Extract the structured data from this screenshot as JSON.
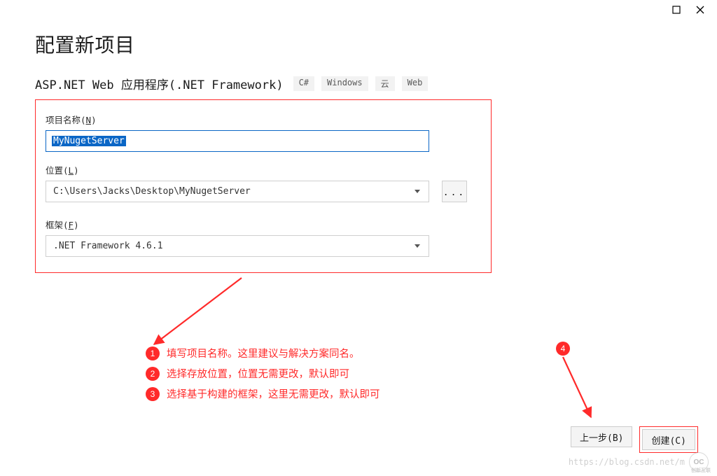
{
  "titlebar": {
    "maximize_icon": "maximize",
    "close_icon": "close"
  },
  "header": {
    "title": "配置新项目",
    "project_type": "ASP.NET Web 应用程序(.NET Framework)",
    "tags": [
      "C#",
      "Windows",
      "云",
      "Web"
    ]
  },
  "form": {
    "project_name": {
      "label_pre": "项目名称(",
      "hotkey": "N",
      "label_post": ")",
      "value": "MyNugetServer"
    },
    "location": {
      "label_pre": "位置(",
      "hotkey": "L",
      "label_post": ")",
      "value": "C:\\Users\\Jacks\\Desktop\\MyNugetServer",
      "browse": "..."
    },
    "framework": {
      "label_pre": "框架(",
      "hotkey": "F",
      "label_post": ")",
      "value": ".NET Framework 4.6.1"
    }
  },
  "annotations": {
    "items": [
      {
        "n": "1",
        "text": "填写项目名称。这里建议与解决方案同名。"
      },
      {
        "n": "2",
        "text": "选择存放位置，位置无需更改，默认即可"
      },
      {
        "n": "3",
        "text": "选择基于构建的框架，这里无需更改，默认即可"
      }
    ],
    "four": "4"
  },
  "buttons": {
    "back": "上一步(B)",
    "create": "创建(C)"
  },
  "watermark": {
    "url": "https://blog.csdn.net/m",
    "logo": "OC",
    "brand": "创新互联"
  }
}
